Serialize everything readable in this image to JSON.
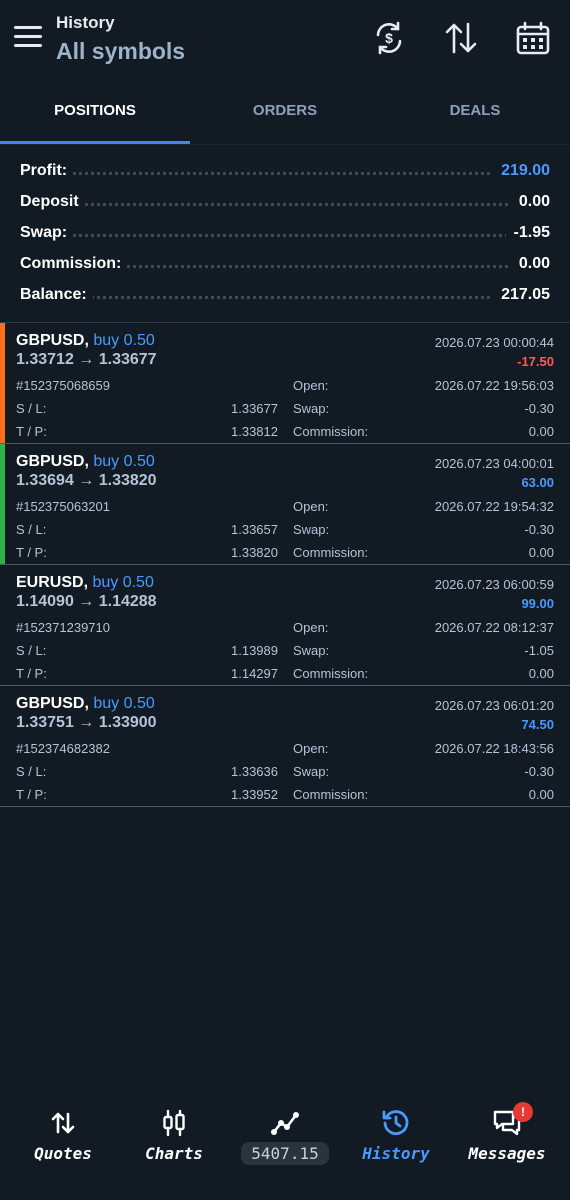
{
  "header": {
    "subtitle": "History",
    "title": "All symbols",
    "icons": [
      "currency-exchange-icon",
      "sort-icon",
      "calendar-icon"
    ]
  },
  "tabs": [
    {
      "label": "POSITIONS",
      "active": true
    },
    {
      "label": "ORDERS",
      "active": false
    },
    {
      "label": "DEALS",
      "active": false
    }
  ],
  "summary": [
    {
      "label": "Profit:",
      "value": "219.00",
      "highlight": true
    },
    {
      "label": "Deposit",
      "value": "0.00",
      "highlight": false
    },
    {
      "label": "Swap:",
      "value": "-1.95",
      "highlight": false
    },
    {
      "label": "Commission:",
      "value": "0.00",
      "highlight": false
    },
    {
      "label": "Balance:",
      "value": "217.05",
      "highlight": false
    }
  ],
  "deals": [
    {
      "symbol": "GBPUSD,",
      "side": " buy 0.50",
      "price": "1.33712 → 1.33677",
      "close_time": "2026.07.23 00:00:44",
      "profit": "-17.50",
      "id": "#152375068659",
      "sl_label": "S / L:",
      "sl": "1.33677",
      "tp_label": "T / P:",
      "tp": "1.33812",
      "open_label": "Open:",
      "open_time": "2026.07.22 19:56:03",
      "swap_label": "Swap:",
      "swap": "-0.30",
      "comm_label": "Commission:",
      "commission": "0.00",
      "bar_color": "#ff6f1a"
    },
    {
      "symbol": "GBPUSD,",
      "side": " buy 0.50",
      "price": "1.33694 → 1.33820",
      "close_time": "2026.07.23 04:00:01",
      "profit": "63.00",
      "id": "#152375063201",
      "sl_label": "S / L:",
      "sl": "1.33657",
      "tp_label": "T / P:",
      "tp": "1.33820",
      "open_label": "Open:",
      "open_time": "2026.07.22 19:54:32",
      "swap_label": "Swap:",
      "swap": "-0.30",
      "comm_label": "Commission:",
      "commission": "0.00",
      "bar_color": "#2fb34a"
    },
    {
      "symbol": "EURUSD,",
      "side": " buy 0.50",
      "price": "1.14090 → 1.14288",
      "close_time": "2026.07.23 06:00:59",
      "profit": "99.00",
      "id": "#152371239710",
      "sl_label": "S / L:",
      "sl": "1.13989",
      "tp_label": "T / P:",
      "tp": "1.14297",
      "open_label": "Open:",
      "open_time": "2026.07.22 08:12:37",
      "swap_label": "Swap:",
      "swap": "-1.05",
      "comm_label": "Commission:",
      "commission": "0.00",
      "bar_color": ""
    },
    {
      "symbol": "GBPUSD,",
      "side": " buy 0.50",
      "price": "1.33751 → 1.33900",
      "close_time": "2026.07.23 06:01:20",
      "profit": "74.50",
      "id": "#152374682382",
      "sl_label": "S / L:",
      "sl": "1.33636",
      "tp_label": "T / P:",
      "tp": "1.33952",
      "open_label": "Open:",
      "open_time": "2026.07.22 18:43:56",
      "swap_label": "Swap:",
      "swap": "-0.30",
      "comm_label": "Commission:",
      "commission": "0.00",
      "bar_color": ""
    }
  ],
  "bottom_nav": {
    "items": [
      {
        "label": "Quotes",
        "icon": "quotes-arrows-icon"
      },
      {
        "label": "Charts",
        "icon": "candlestick-icon"
      },
      {
        "label": "",
        "icon": "trade-line-icon"
      },
      {
        "label": "History",
        "icon": "history-clock-icon",
        "active": true
      },
      {
        "label": "Messages",
        "icon": "messages-icon"
      }
    ],
    "chip_value": "5407.15",
    "badge": "!"
  },
  "colors": {
    "background": "#121a24",
    "accent": "#4a9aff",
    "loss": "#ff5a5a"
  }
}
